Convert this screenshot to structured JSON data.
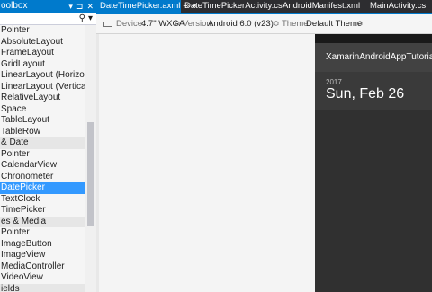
{
  "toolbox": {
    "title": "oolbox",
    "search_placeholder": "",
    "header_icons": [
      "▾",
      "⊐",
      "✕"
    ],
    "items": [
      {
        "label": "Pointer",
        "category": false,
        "selected": false
      },
      {
        "label": "AbsoluteLayout",
        "category": false,
        "selected": false
      },
      {
        "label": "FrameLayout",
        "category": false,
        "selected": false
      },
      {
        "label": "GridLayout",
        "category": false,
        "selected": false
      },
      {
        "label": "LinearLayout (Horizontal)",
        "category": false,
        "selected": false
      },
      {
        "label": "LinearLayout (Vertical)",
        "category": false,
        "selected": false
      },
      {
        "label": "RelativeLayout",
        "category": false,
        "selected": false
      },
      {
        "label": "Space",
        "category": false,
        "selected": false
      },
      {
        "label": "TableLayout",
        "category": false,
        "selected": false
      },
      {
        "label": "TableRow",
        "category": false,
        "selected": false
      },
      {
        "label": "& Date",
        "category": true,
        "selected": false
      },
      {
        "label": "Pointer",
        "category": false,
        "selected": false
      },
      {
        "label": "CalendarView",
        "category": false,
        "selected": false
      },
      {
        "label": "Chronometer",
        "category": false,
        "selected": false
      },
      {
        "label": "DatePicker",
        "category": false,
        "selected": true
      },
      {
        "label": "TextClock",
        "category": false,
        "selected": false
      },
      {
        "label": "TimePicker",
        "category": false,
        "selected": false
      },
      {
        "label": "es & Media",
        "category": true,
        "selected": false
      },
      {
        "label": "Pointer",
        "category": false,
        "selected": false
      },
      {
        "label": "ImageButton",
        "category": false,
        "selected": false
      },
      {
        "label": "ImageView",
        "category": false,
        "selected": false
      },
      {
        "label": "MediaController",
        "category": false,
        "selected": false
      },
      {
        "label": "VideoView",
        "category": false,
        "selected": false
      },
      {
        "label": "ields",
        "category": true,
        "selected": false
      }
    ]
  },
  "tabs": [
    {
      "label": "DateTimePicker.axml",
      "active": true
    },
    {
      "label": "DateTimePickerActivity.cs",
      "active": false
    },
    {
      "label": "AndroidManifest.xml",
      "active": false
    },
    {
      "label": "MainActivity.cs",
      "active": false
    }
  ],
  "designer_toolbar": {
    "device_label": "Device:",
    "device_value": "4.7\" WXGA",
    "version_label": "Version:",
    "version_value": "Android 6.0 (v23)",
    "theme_label": "Theme:",
    "theme_value": "Default Theme"
  },
  "app": {
    "title": "XamarinAndroidAppTutorial",
    "year": "2017",
    "date": "Sun, Feb 26"
  },
  "colors": {
    "accent": "#007acc",
    "selection": "#3399ff",
    "app_bar": "#424242",
    "device_bg": "#303030"
  }
}
